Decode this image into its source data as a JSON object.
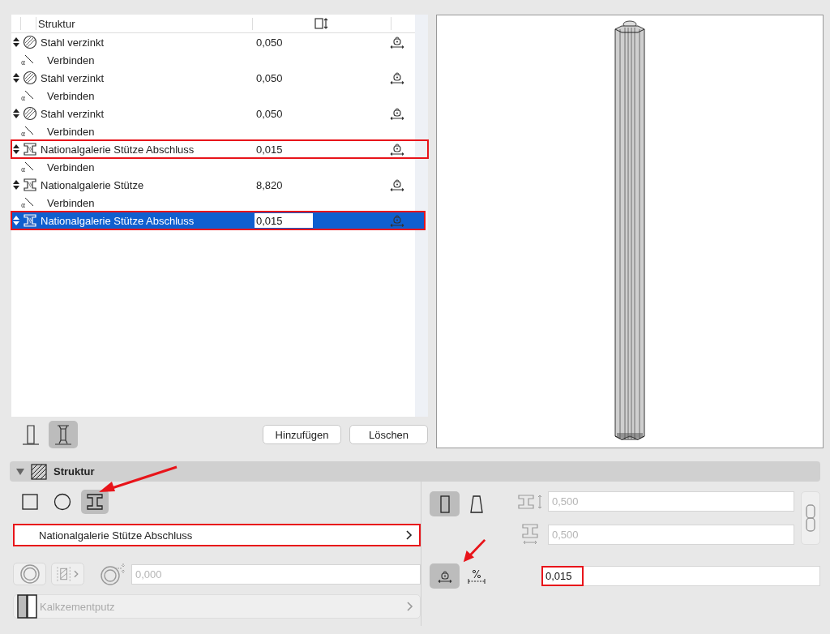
{
  "table": {
    "columns": [
      "Struktur"
    ],
    "rows": [
      {
        "kind": "material",
        "name": "Stahl verzinkt",
        "value": "0,050",
        "selected": false,
        "highlighted": false,
        "children": [
          {
            "symbol": "α",
            "label": "Verbinden"
          }
        ]
      },
      {
        "kind": "material",
        "name": "Stahl verzinkt",
        "value": "0,050",
        "selected": false,
        "highlighted": false,
        "children": [
          {
            "symbol": "α",
            "label": "Verbinden"
          }
        ]
      },
      {
        "kind": "material",
        "name": "Stahl verzinkt",
        "value": "0,050",
        "selected": false,
        "highlighted": false,
        "children": [
          {
            "symbol": "α",
            "label": "Verbinden"
          }
        ]
      },
      {
        "kind": "profile",
        "name": "Nationalgalerie Stütze Abschluss",
        "value": "0,015",
        "selected": false,
        "highlighted": true,
        "children": [
          {
            "symbol": "α",
            "label": "Verbinden"
          }
        ]
      },
      {
        "kind": "profile",
        "name": "Nationalgalerie Stütze",
        "value": "8,820",
        "selected": false,
        "highlighted": false,
        "children": [
          {
            "symbol": "α",
            "label": "Verbinden"
          }
        ]
      },
      {
        "kind": "profile",
        "name": "Nationalgalerie Stütze Abschluss",
        "value": "0,015",
        "selected": true,
        "highlighted": true,
        "children": []
      }
    ]
  },
  "view_toggle": [
    {
      "kind": "straight",
      "selected": false
    },
    {
      "kind": "tapered",
      "selected": true
    }
  ],
  "buttons": [
    "Hinzufügen",
    "Löschen"
  ],
  "section": {
    "title": "Struktur",
    "expanded": true
  },
  "shape_options": [
    {
      "kind": "rectangle",
      "selected": false
    },
    {
      "kind": "circle",
      "selected": false
    },
    {
      "kind": "profile",
      "selected": true
    }
  ],
  "profile_selector": {
    "value": "Nationalgalerie Stütze Abschluss",
    "highlighted": true
  },
  "offset_field": {
    "value": "0,000",
    "disabled": true
  },
  "surface": {
    "value": "Kalkzementputz",
    "disabled": true
  },
  "orientation": [
    {
      "kind": "straight",
      "selected": true
    },
    {
      "kind": "tapered",
      "selected": false
    }
  ],
  "width_field": {
    "value": "0,500",
    "disabled": true
  },
  "height_field": {
    "value": "0,500",
    "disabled": true
  },
  "size_mode": [
    {
      "kind": "fixed",
      "selected": true
    },
    {
      "kind": "percent",
      "selected": false
    }
  ],
  "thickness_field": {
    "value": "0,015",
    "highlighted": true
  }
}
